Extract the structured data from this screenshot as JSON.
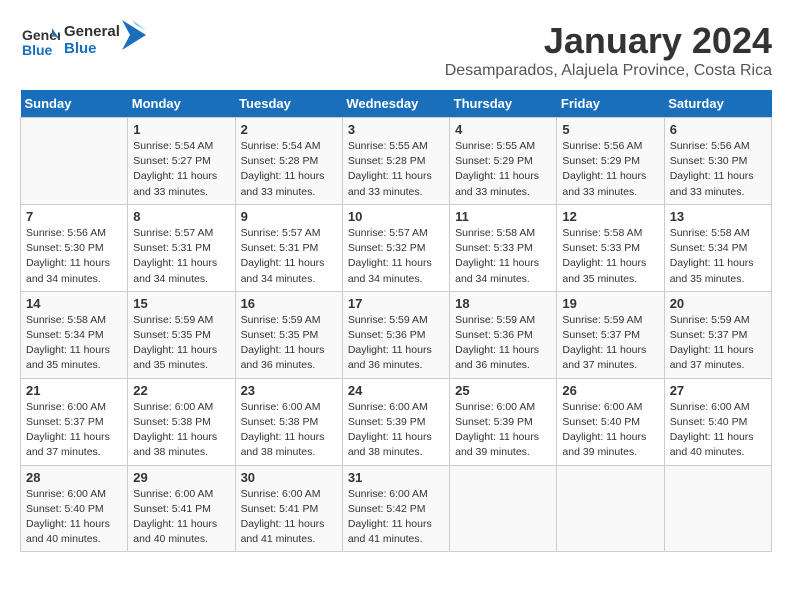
{
  "logo": {
    "line1": "General",
    "line2": "Blue"
  },
  "title": "January 2024",
  "location": "Desamparados, Alajuela Province, Costa Rica",
  "weekdays": [
    "Sunday",
    "Monday",
    "Tuesday",
    "Wednesday",
    "Thursday",
    "Friday",
    "Saturday"
  ],
  "weeks": [
    [
      {
        "day": "",
        "sunrise": "",
        "sunset": "",
        "daylight": ""
      },
      {
        "day": "1",
        "sunrise": "Sunrise: 5:54 AM",
        "sunset": "Sunset: 5:27 PM",
        "daylight": "Daylight: 11 hours and 33 minutes."
      },
      {
        "day": "2",
        "sunrise": "Sunrise: 5:54 AM",
        "sunset": "Sunset: 5:28 PM",
        "daylight": "Daylight: 11 hours and 33 minutes."
      },
      {
        "day": "3",
        "sunrise": "Sunrise: 5:55 AM",
        "sunset": "Sunset: 5:28 PM",
        "daylight": "Daylight: 11 hours and 33 minutes."
      },
      {
        "day": "4",
        "sunrise": "Sunrise: 5:55 AM",
        "sunset": "Sunset: 5:29 PM",
        "daylight": "Daylight: 11 hours and 33 minutes."
      },
      {
        "day": "5",
        "sunrise": "Sunrise: 5:56 AM",
        "sunset": "Sunset: 5:29 PM",
        "daylight": "Daylight: 11 hours and 33 minutes."
      },
      {
        "day": "6",
        "sunrise": "Sunrise: 5:56 AM",
        "sunset": "Sunset: 5:30 PM",
        "daylight": "Daylight: 11 hours and 33 minutes."
      }
    ],
    [
      {
        "day": "7",
        "sunrise": "Sunrise: 5:56 AM",
        "sunset": "Sunset: 5:30 PM",
        "daylight": "Daylight: 11 hours and 34 minutes."
      },
      {
        "day": "8",
        "sunrise": "Sunrise: 5:57 AM",
        "sunset": "Sunset: 5:31 PM",
        "daylight": "Daylight: 11 hours and 34 minutes."
      },
      {
        "day": "9",
        "sunrise": "Sunrise: 5:57 AM",
        "sunset": "Sunset: 5:31 PM",
        "daylight": "Daylight: 11 hours and 34 minutes."
      },
      {
        "day": "10",
        "sunrise": "Sunrise: 5:57 AM",
        "sunset": "Sunset: 5:32 PM",
        "daylight": "Daylight: 11 hours and 34 minutes."
      },
      {
        "day": "11",
        "sunrise": "Sunrise: 5:58 AM",
        "sunset": "Sunset: 5:33 PM",
        "daylight": "Daylight: 11 hours and 34 minutes."
      },
      {
        "day": "12",
        "sunrise": "Sunrise: 5:58 AM",
        "sunset": "Sunset: 5:33 PM",
        "daylight": "Daylight: 11 hours and 35 minutes."
      },
      {
        "day": "13",
        "sunrise": "Sunrise: 5:58 AM",
        "sunset": "Sunset: 5:34 PM",
        "daylight": "Daylight: 11 hours and 35 minutes."
      }
    ],
    [
      {
        "day": "14",
        "sunrise": "Sunrise: 5:58 AM",
        "sunset": "Sunset: 5:34 PM",
        "daylight": "Daylight: 11 hours and 35 minutes."
      },
      {
        "day": "15",
        "sunrise": "Sunrise: 5:59 AM",
        "sunset": "Sunset: 5:35 PM",
        "daylight": "Daylight: 11 hours and 35 minutes."
      },
      {
        "day": "16",
        "sunrise": "Sunrise: 5:59 AM",
        "sunset": "Sunset: 5:35 PM",
        "daylight": "Daylight: 11 hours and 36 minutes."
      },
      {
        "day": "17",
        "sunrise": "Sunrise: 5:59 AM",
        "sunset": "Sunset: 5:36 PM",
        "daylight": "Daylight: 11 hours and 36 minutes."
      },
      {
        "day": "18",
        "sunrise": "Sunrise: 5:59 AM",
        "sunset": "Sunset: 5:36 PM",
        "daylight": "Daylight: 11 hours and 36 minutes."
      },
      {
        "day": "19",
        "sunrise": "Sunrise: 5:59 AM",
        "sunset": "Sunset: 5:37 PM",
        "daylight": "Daylight: 11 hours and 37 minutes."
      },
      {
        "day": "20",
        "sunrise": "Sunrise: 5:59 AM",
        "sunset": "Sunset: 5:37 PM",
        "daylight": "Daylight: 11 hours and 37 minutes."
      }
    ],
    [
      {
        "day": "21",
        "sunrise": "Sunrise: 6:00 AM",
        "sunset": "Sunset: 5:37 PM",
        "daylight": "Daylight: 11 hours and 37 minutes."
      },
      {
        "day": "22",
        "sunrise": "Sunrise: 6:00 AM",
        "sunset": "Sunset: 5:38 PM",
        "daylight": "Daylight: 11 hours and 38 minutes."
      },
      {
        "day": "23",
        "sunrise": "Sunrise: 6:00 AM",
        "sunset": "Sunset: 5:38 PM",
        "daylight": "Daylight: 11 hours and 38 minutes."
      },
      {
        "day": "24",
        "sunrise": "Sunrise: 6:00 AM",
        "sunset": "Sunset: 5:39 PM",
        "daylight": "Daylight: 11 hours and 38 minutes."
      },
      {
        "day": "25",
        "sunrise": "Sunrise: 6:00 AM",
        "sunset": "Sunset: 5:39 PM",
        "daylight": "Daylight: 11 hours and 39 minutes."
      },
      {
        "day": "26",
        "sunrise": "Sunrise: 6:00 AM",
        "sunset": "Sunset: 5:40 PM",
        "daylight": "Daylight: 11 hours and 39 minutes."
      },
      {
        "day": "27",
        "sunrise": "Sunrise: 6:00 AM",
        "sunset": "Sunset: 5:40 PM",
        "daylight": "Daylight: 11 hours and 40 minutes."
      }
    ],
    [
      {
        "day": "28",
        "sunrise": "Sunrise: 6:00 AM",
        "sunset": "Sunset: 5:40 PM",
        "daylight": "Daylight: 11 hours and 40 minutes."
      },
      {
        "day": "29",
        "sunrise": "Sunrise: 6:00 AM",
        "sunset": "Sunset: 5:41 PM",
        "daylight": "Daylight: 11 hours and 40 minutes."
      },
      {
        "day": "30",
        "sunrise": "Sunrise: 6:00 AM",
        "sunset": "Sunset: 5:41 PM",
        "daylight": "Daylight: 11 hours and 41 minutes."
      },
      {
        "day": "31",
        "sunrise": "Sunrise: 6:00 AM",
        "sunset": "Sunset: 5:42 PM",
        "daylight": "Daylight: 11 hours and 41 minutes."
      },
      {
        "day": "",
        "sunrise": "",
        "sunset": "",
        "daylight": ""
      },
      {
        "day": "",
        "sunrise": "",
        "sunset": "",
        "daylight": ""
      },
      {
        "day": "",
        "sunrise": "",
        "sunset": "",
        "daylight": ""
      }
    ]
  ]
}
